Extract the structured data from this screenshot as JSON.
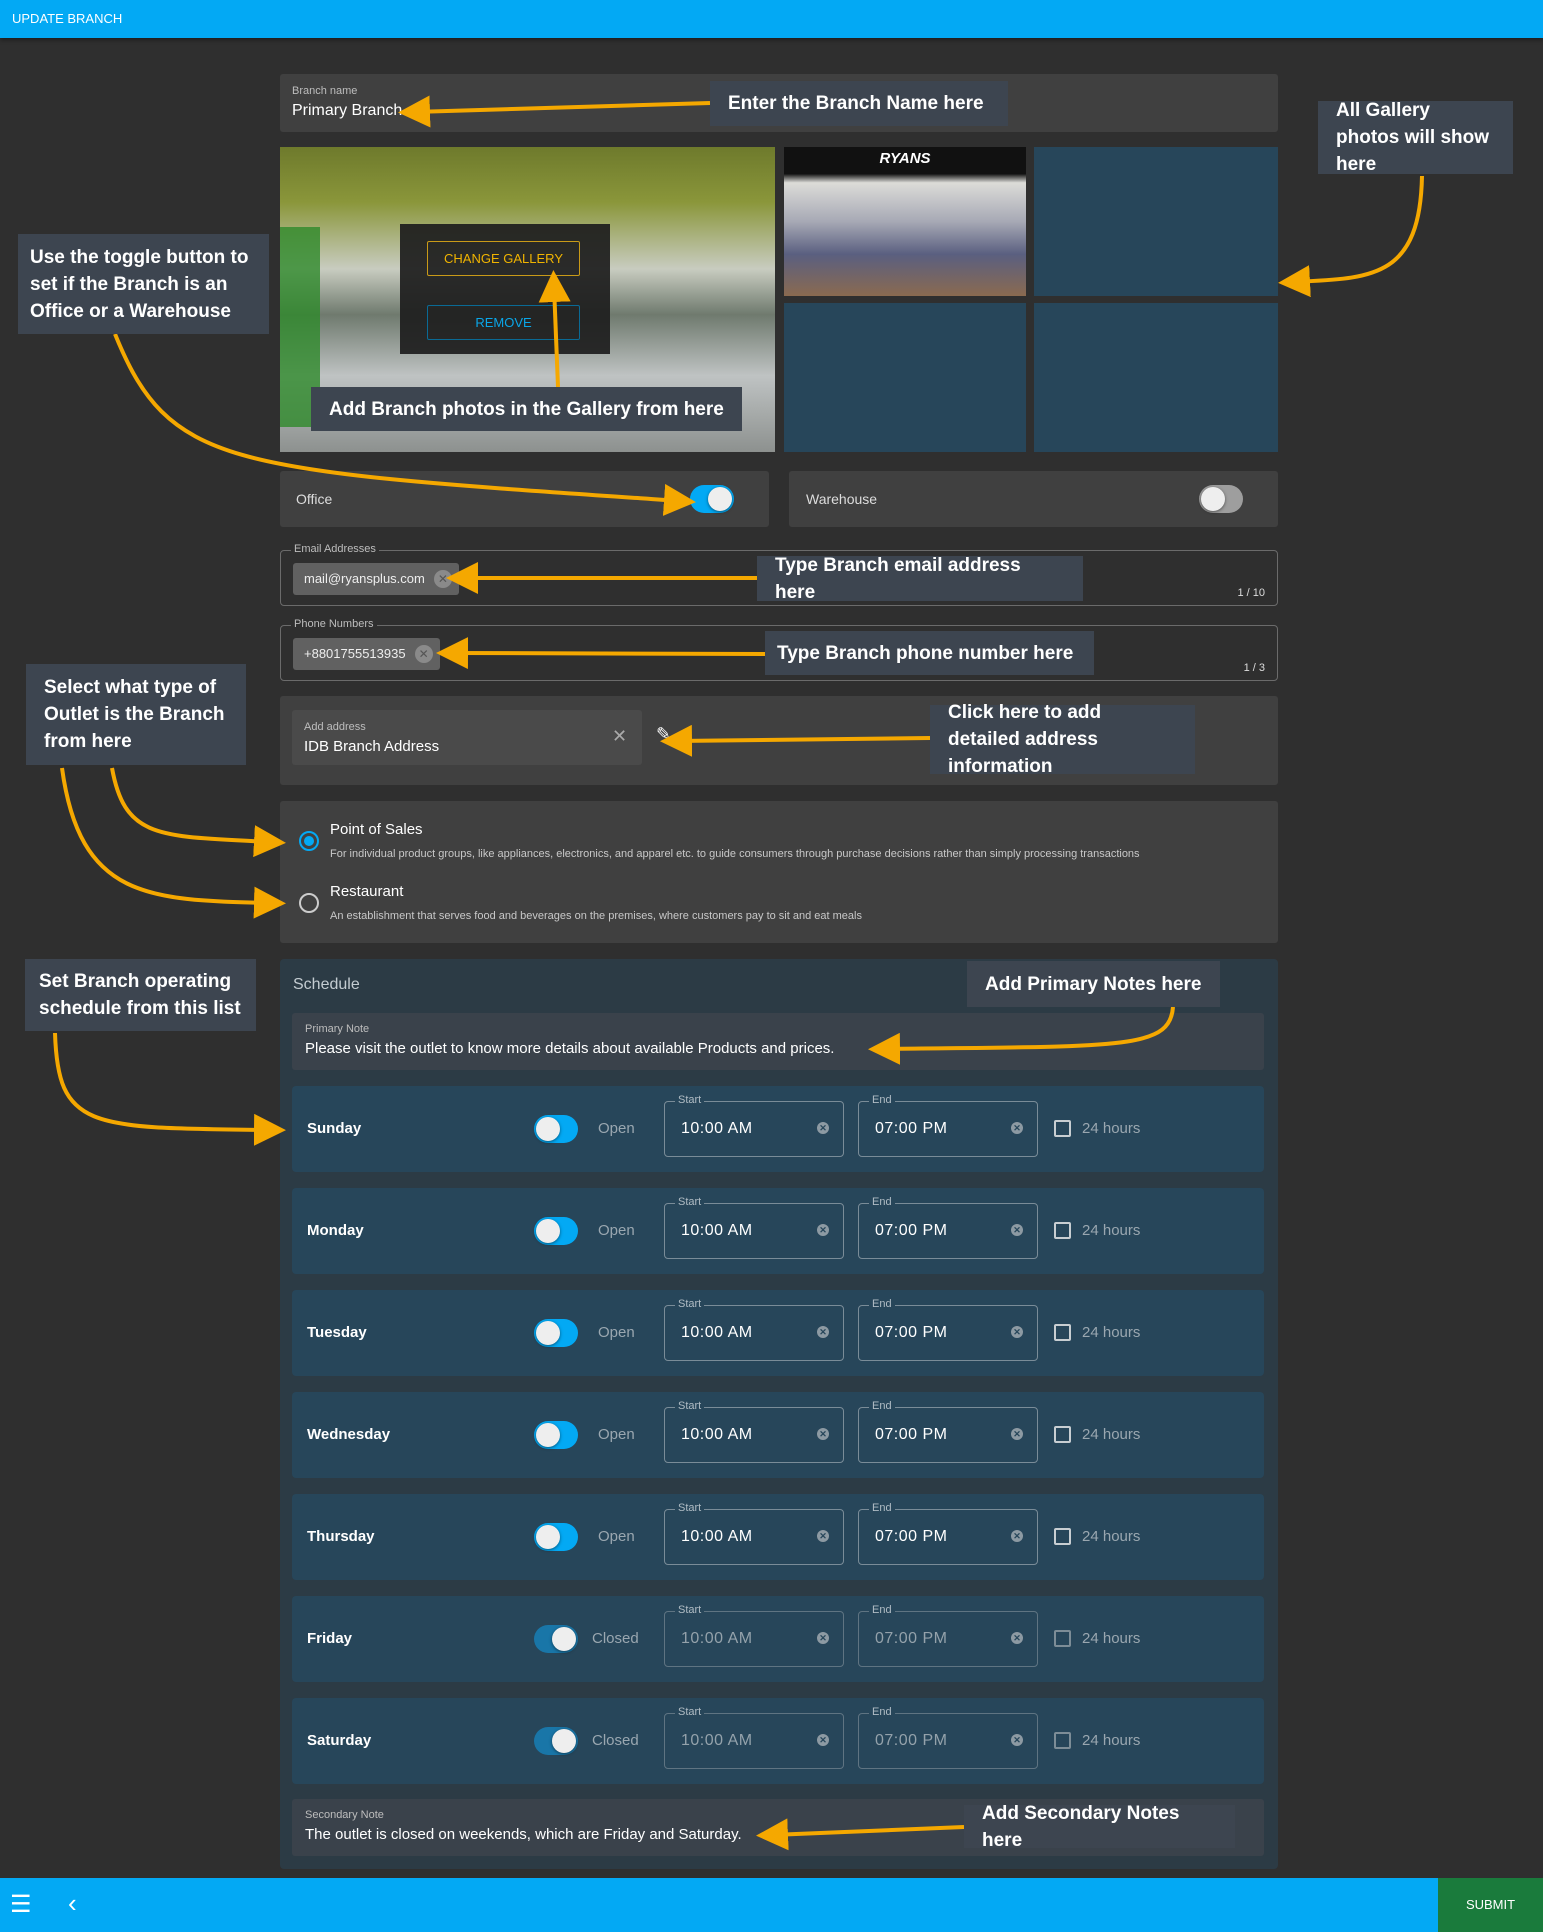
{
  "header": {
    "title": "UPDATE BRANCH"
  },
  "branch_name": {
    "label": "Branch name",
    "value": "Primary Branch"
  },
  "gallery": {
    "change_label": "CHANGE GALLERY",
    "remove_label": "REMOVE",
    "thumbnail_logo": "RYANS",
    "empty_slots": 3
  },
  "branch_type": {
    "office_label": "Office",
    "office_on": true,
    "warehouse_label": "Warehouse",
    "warehouse_on": false
  },
  "emails": {
    "label": "Email Addresses",
    "items": [
      "mail@ryansplus.com"
    ],
    "counter": "1 / 10"
  },
  "phones": {
    "label": "Phone Numbers",
    "items": [
      "+8801755513935"
    ],
    "counter": "1 / 3"
  },
  "address": {
    "label": "Add address",
    "value": "IDB Branch Address",
    "icons": [
      "close-icon",
      "pencil-icon"
    ]
  },
  "outlet_types": [
    {
      "title": "Point of Sales",
      "description": "For individual product groups, like appliances, electronics, and apparel etc. to guide consumers through purchase decisions rather than simply processing transactions",
      "selected": true
    },
    {
      "title": "Restaurant",
      "description": "An establishment that serves food and beverages on the premises, where customers pay to sit and eat meals",
      "selected": false
    }
  ],
  "schedule": {
    "title": "Schedule",
    "primary_note": {
      "label": "Primary Note",
      "value": "Please visit the outlet to know more details about available Products and prices."
    },
    "start_label": "Start",
    "end_label": "End",
    "full_day_label": "24 hours",
    "days": [
      {
        "day": "Sunday",
        "state": "Open",
        "start": "10:00 AM",
        "end": "07:00 PM",
        "open": true
      },
      {
        "day": "Monday",
        "state": "Open",
        "start": "10:00 AM",
        "end": "07:00 PM",
        "open": true
      },
      {
        "day": "Tuesday",
        "state": "Open",
        "start": "10:00 AM",
        "end": "07:00 PM",
        "open": true
      },
      {
        "day": "Wednesday",
        "state": "Open",
        "start": "10:00 AM",
        "end": "07:00 PM",
        "open": true
      },
      {
        "day": "Thursday",
        "state": "Open",
        "start": "10:00 AM",
        "end": "07:00 PM",
        "open": true
      },
      {
        "day": "Friday",
        "state": "Closed",
        "start": "10:00 AM",
        "end": "07:00 PM",
        "open": false
      },
      {
        "day": "Saturday",
        "state": "Closed",
        "start": "10:00 AM",
        "end": "07:00 PM",
        "open": false
      }
    ],
    "secondary_note": {
      "label": "Secondary Note",
      "value": "The outlet is closed on weekends, which are Friday and Saturday."
    }
  },
  "footer": {
    "submit_label": "SUBMIT",
    "icons": [
      "menu-icon",
      "back-chevron-icon"
    ]
  },
  "annotations": {
    "branch_name": "Enter the Branch Name here",
    "gallery": "All Gallery photos will show here",
    "toggle": "Use the toggle button to set if the Branch is an Office or a Warehouse",
    "photos": "Add Branch photos in the Gallery from here",
    "email": "Type Branch email address here",
    "phone": "Type Branch phone number here",
    "outlet": "Select what type of Outlet is the Branch from here",
    "address": "Click here to add detailed address information",
    "schedule": "Set Branch operating schedule from this list",
    "primary_note": "Add Primary Notes here",
    "secondary_note": "Add Secondary Notes here"
  },
  "colors": {
    "header": "#03a9f4",
    "submit": "#1a7b3c",
    "annotation_arrow": "#f5a800",
    "annotation_box": "#3d4550",
    "schedule_row": "#27465a"
  }
}
